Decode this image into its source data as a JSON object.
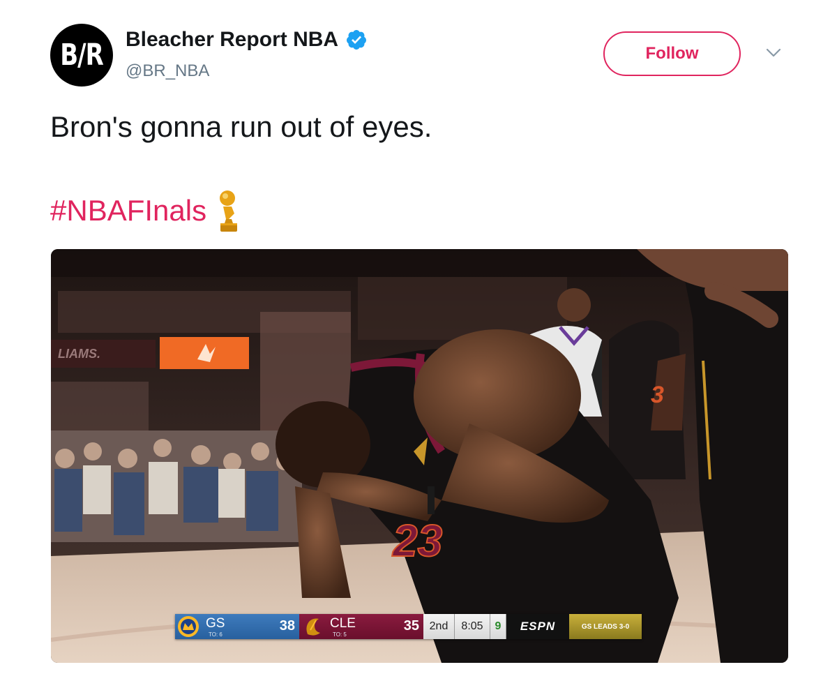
{
  "tweet": {
    "author": {
      "avatar_text": "B/R",
      "display_name": "Bleacher Report NBA",
      "handle": "@BR_NBA",
      "verified": true
    },
    "follow_label": "Follow",
    "text": "Bron's gonna run out of eyes.",
    "hashtag": "#NBAFInals",
    "emoji": "trophy-icon",
    "accent_color": "#e0245e",
    "verified_color": "#1da1f2"
  },
  "media": {
    "arena_sign": "LIAMS.",
    "scoreboard": {
      "away_abbr": "GS",
      "away_timeouts": "TO: 6",
      "away_score": "38",
      "home_abbr": "CLE",
      "home_timeouts": "TO: 5",
      "home_score": "35",
      "quarter": "2nd",
      "clock": "8:05",
      "shot_clock": "9",
      "network": "ESPN",
      "series_status": "GS LEADS 3-0",
      "away_color": "#3a74b5",
      "home_color": "#7d1838"
    }
  }
}
